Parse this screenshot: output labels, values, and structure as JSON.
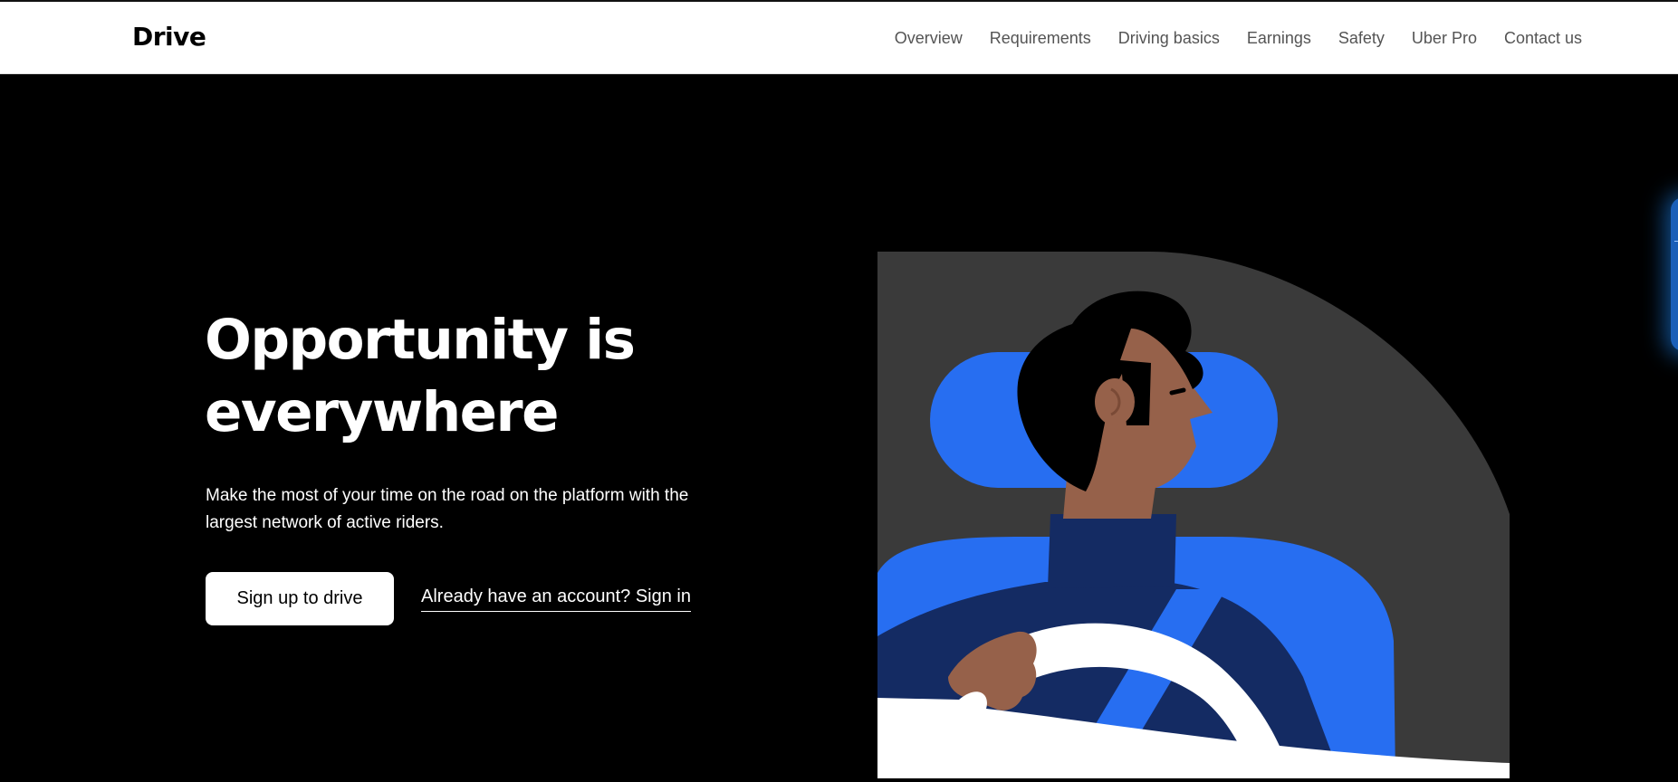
{
  "header": {
    "logo": "Drive",
    "nav": [
      "Overview",
      "Requirements",
      "Driving basics",
      "Earnings",
      "Safety",
      "Uber Pro",
      "Contact us"
    ]
  },
  "hero": {
    "title": "Opportunity is everywhere",
    "subtitle": "Make the most of your time on the road on the platform with the largest network of active riders.",
    "signup_label": "Sign up to drive",
    "signin_label": "Already have an account? Sign in"
  },
  "illustration": {
    "icon": "driver-illustration",
    "colors": {
      "car_interior": "#3a3a3a",
      "headrest": "#276ef1",
      "jacket": "#142b63",
      "skin": "#96614a",
      "hair": "#000000",
      "wheel": "#ffffff"
    }
  },
  "colors": {
    "background": "#000000",
    "header_bg": "#ffffff",
    "nav_text": "#545454",
    "accent": "#276ef1"
  }
}
